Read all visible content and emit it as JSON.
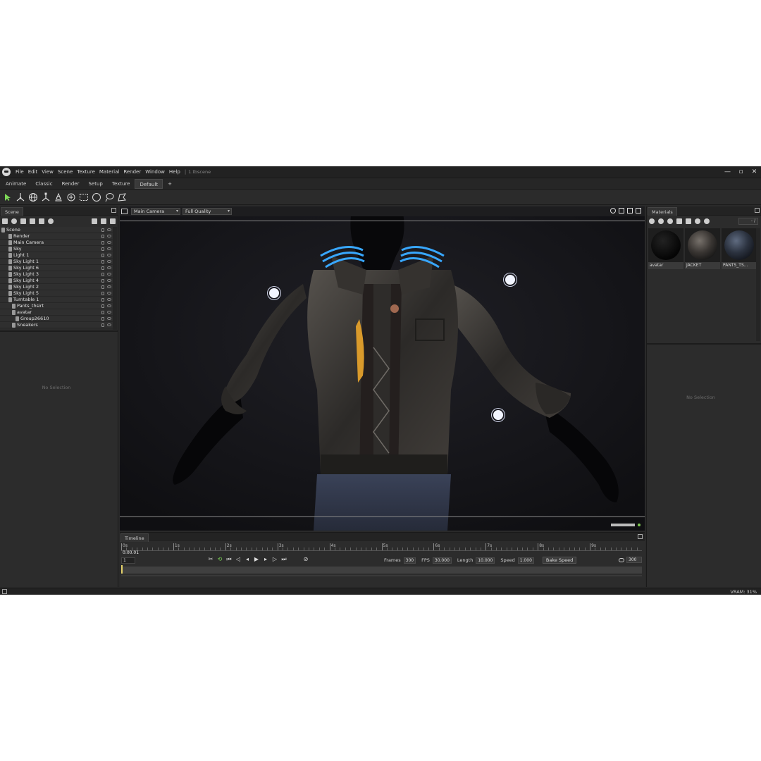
{
  "menu": {
    "items": [
      "File",
      "Edit",
      "View",
      "Scene",
      "Texture",
      "Material",
      "Render",
      "Window",
      "Help"
    ],
    "separator": "|",
    "file_title": "1.tbscene"
  },
  "window_controls": {
    "minimize": "—",
    "maximize": "▫",
    "close": "✕"
  },
  "workspace_tabs": [
    "Animate",
    "Classic",
    "Render",
    "Setup",
    "Texture",
    "Default",
    "+"
  ],
  "active_workspace": "Default",
  "toolbar": [
    "select-arrow-icon",
    "translate-icon",
    "rotate-icon",
    "scale-icon",
    "camera-icon",
    "sculpt-icon",
    "rect-select-icon",
    "circle-select-icon",
    "lasso-icon",
    "poly-select-icon"
  ],
  "scene_panel": {
    "tab": "Scene",
    "tree": [
      {
        "label": "Scene",
        "indent": 0
      },
      {
        "label": "Render",
        "indent": 2
      },
      {
        "label": "Main Camera",
        "indent": 2
      },
      {
        "label": "Sky",
        "indent": 2
      },
      {
        "label": "Light 1",
        "indent": 2
      },
      {
        "label": "Sky Light 1",
        "indent": 2
      },
      {
        "label": "Sky Light 6",
        "indent": 2
      },
      {
        "label": "Sky Light 3",
        "indent": 2
      },
      {
        "label": "Sky Light 4",
        "indent": 2
      },
      {
        "label": "Sky Light 2",
        "indent": 2
      },
      {
        "label": "Sky Light 5",
        "indent": 2
      },
      {
        "label": "Turntable 1",
        "indent": 2
      },
      {
        "label": "Pants_thsirt",
        "indent": 3
      },
      {
        "label": "avatar",
        "indent": 3
      },
      {
        "label": "Group26610",
        "indent": 4
      },
      {
        "label": "Sneakers",
        "indent": 3
      }
    ],
    "no_selection": "No Selection"
  },
  "viewport": {
    "camera": "Main Camera",
    "quality": "Full Quality",
    "status_color": "#7ec850"
  },
  "materials_panel": {
    "tab": "Materials",
    "filter": "- /",
    "items": [
      {
        "label": "avatar",
        "color": "#0c0c0c"
      },
      {
        "label": "JACKET",
        "color": "#3a3633"
      },
      {
        "label": "PANTS_TS...",
        "color": "#2c3340"
      }
    ],
    "no_selection": "No Selection"
  },
  "timeline": {
    "tab": "Timeline",
    "ticks": [
      "0s",
      "1s",
      "2s",
      "3s",
      "4s",
      "5s",
      "6s",
      "7s",
      "8s",
      "9s"
    ],
    "current_time": "0:00.01",
    "frame": "1",
    "frames_label": "Frames",
    "frames_value": "300",
    "fps_label": "FPS",
    "fps_value": "30.000",
    "length_label": "Length",
    "length_value": "10.000",
    "speed_label": "Speed",
    "speed_value": "1.000",
    "bake_label": "Bake Speed",
    "end_frame": "300"
  },
  "status": {
    "vram": "VRAM: 31%"
  }
}
